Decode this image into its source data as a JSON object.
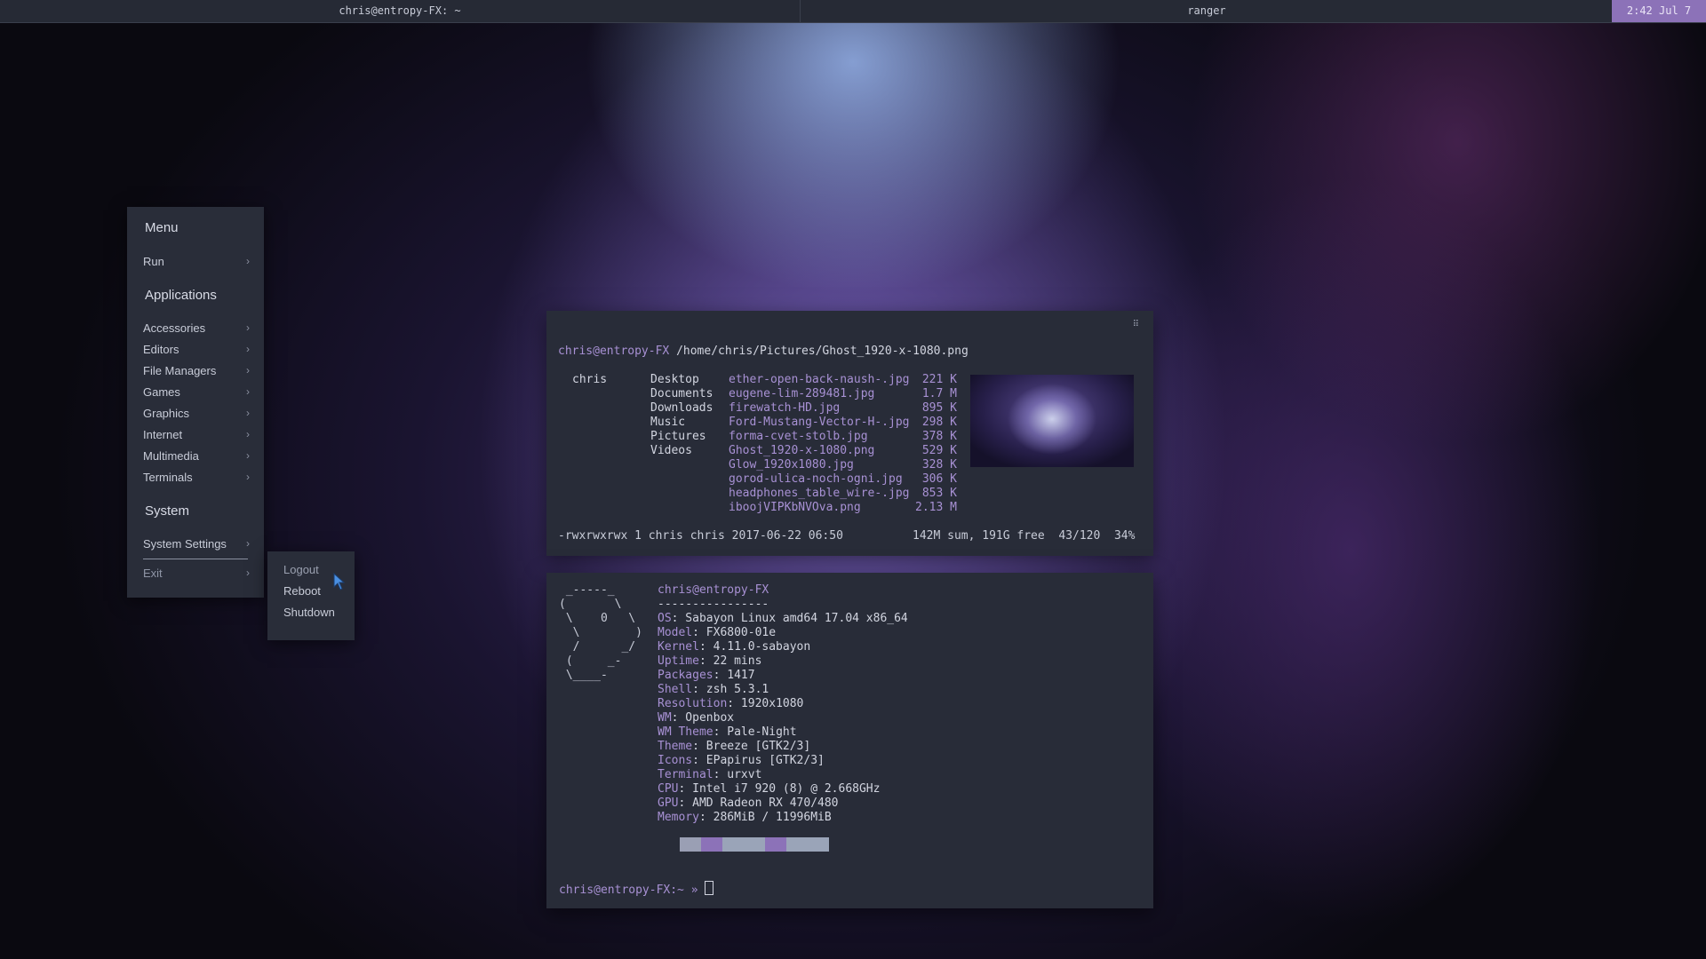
{
  "topbar": {
    "task1": "chris@entropy-FX: ~",
    "task2": "ranger",
    "clock": "2:42 Jul  7"
  },
  "menu": {
    "title": "Menu",
    "run": "Run",
    "applications": "Applications",
    "apps": [
      "Accessories",
      "Editors",
      "File Managers",
      "Games",
      "Graphics",
      "Internet",
      "Multimedia",
      "Terminals"
    ],
    "system": "System",
    "system_settings": "System Settings",
    "exit": "Exit",
    "arrow": "›"
  },
  "exit_submenu": {
    "items": [
      "Logout",
      "Reboot",
      "Shutdown"
    ]
  },
  "ranger": {
    "grip": "⠿",
    "host": "chris@entropy-FX",
    "path": "/home/chris/Pictures/Ghost_1920-x-1080.png",
    "parent": "chris",
    "dirs": [
      "Desktop",
      "Documents",
      "Downloads",
      "Music",
      "Pictures",
      "Videos"
    ],
    "files": [
      {
        "name": "ether-open-back-naush-.jpg",
        "size": "221 K"
      },
      {
        "name": "eugene-lim-289481.jpg",
        "size": "1.7 M"
      },
      {
        "name": "firewatch-HD.jpg",
        "size": "895 K"
      },
      {
        "name": "Ford-Mustang-Vector-H-.jpg",
        "size": "298 K"
      },
      {
        "name": "forma-cvet-stolb.jpg",
        "size": "378 K"
      },
      {
        "name": "Ghost_1920-x-1080.png",
        "size": "529 K"
      },
      {
        "name": "Glow_1920x1080.jpg",
        "size": "328 K"
      },
      {
        "name": "gorod-ulica-noch-ogni.jpg",
        "size": "306 K"
      },
      {
        "name": "headphones_table_wire-.jpg",
        "size": "853 K"
      },
      {
        "name": "iboojVIPKbNVOva.png",
        "size": "2.13 M"
      }
    ],
    "status_left": "-rwxrwxrwx 1 chris chris 2017-06-22 06:50",
    "status_right": "142M sum, 191G free  43/120  34%"
  },
  "neofetch": {
    "ascii": [
      " _-----_",
      "(       \\",
      " \\    0   \\",
      "  \\        )",
      "  /      _/",
      " (     _-",
      " \\____-"
    ],
    "title": "chris@entropy-FX",
    "underline": "----------------",
    "info": [
      {
        "label": "OS",
        "value": ": Sabayon Linux amd64 17.04 x86_64"
      },
      {
        "label": "Model",
        "value": ": FX6800-01e"
      },
      {
        "label": "Kernel",
        "value": ": 4.11.0-sabayon"
      },
      {
        "label": "Uptime",
        "value": ": 22 mins"
      },
      {
        "label": "Packages",
        "value": ": 1417"
      },
      {
        "label": "Shell",
        "value": ": zsh 5.3.1"
      },
      {
        "label": "Resolution",
        "value": ": 1920x1080"
      },
      {
        "label": "WM",
        "value": ": Openbox"
      },
      {
        "label": "WM Theme",
        "value": ": Pale-Night"
      },
      {
        "label": "Theme",
        "value": ": Breeze [GTK2/3]"
      },
      {
        "label": "Icons",
        "value": ": EPapirus [GTK2/3]"
      },
      {
        "label": "Terminal",
        "value": ": urxvt"
      },
      {
        "label": "CPU",
        "value": ": Intel i7 920 (8) @ 2.668GHz"
      },
      {
        "label": "GPU",
        "value": ": AMD Radeon RX 470/480"
      },
      {
        "label": "Memory",
        "value": ": 286MiB / 11996MiB"
      }
    ],
    "color_blocks": [
      "#9a9fb4",
      "#8c72b8",
      "#9aa4b8",
      "#9aa4b8",
      "#8c72b8",
      "#9aa4b8",
      "#9aa4b8"
    ],
    "prompt": "chris@entropy-FX:~ »"
  }
}
